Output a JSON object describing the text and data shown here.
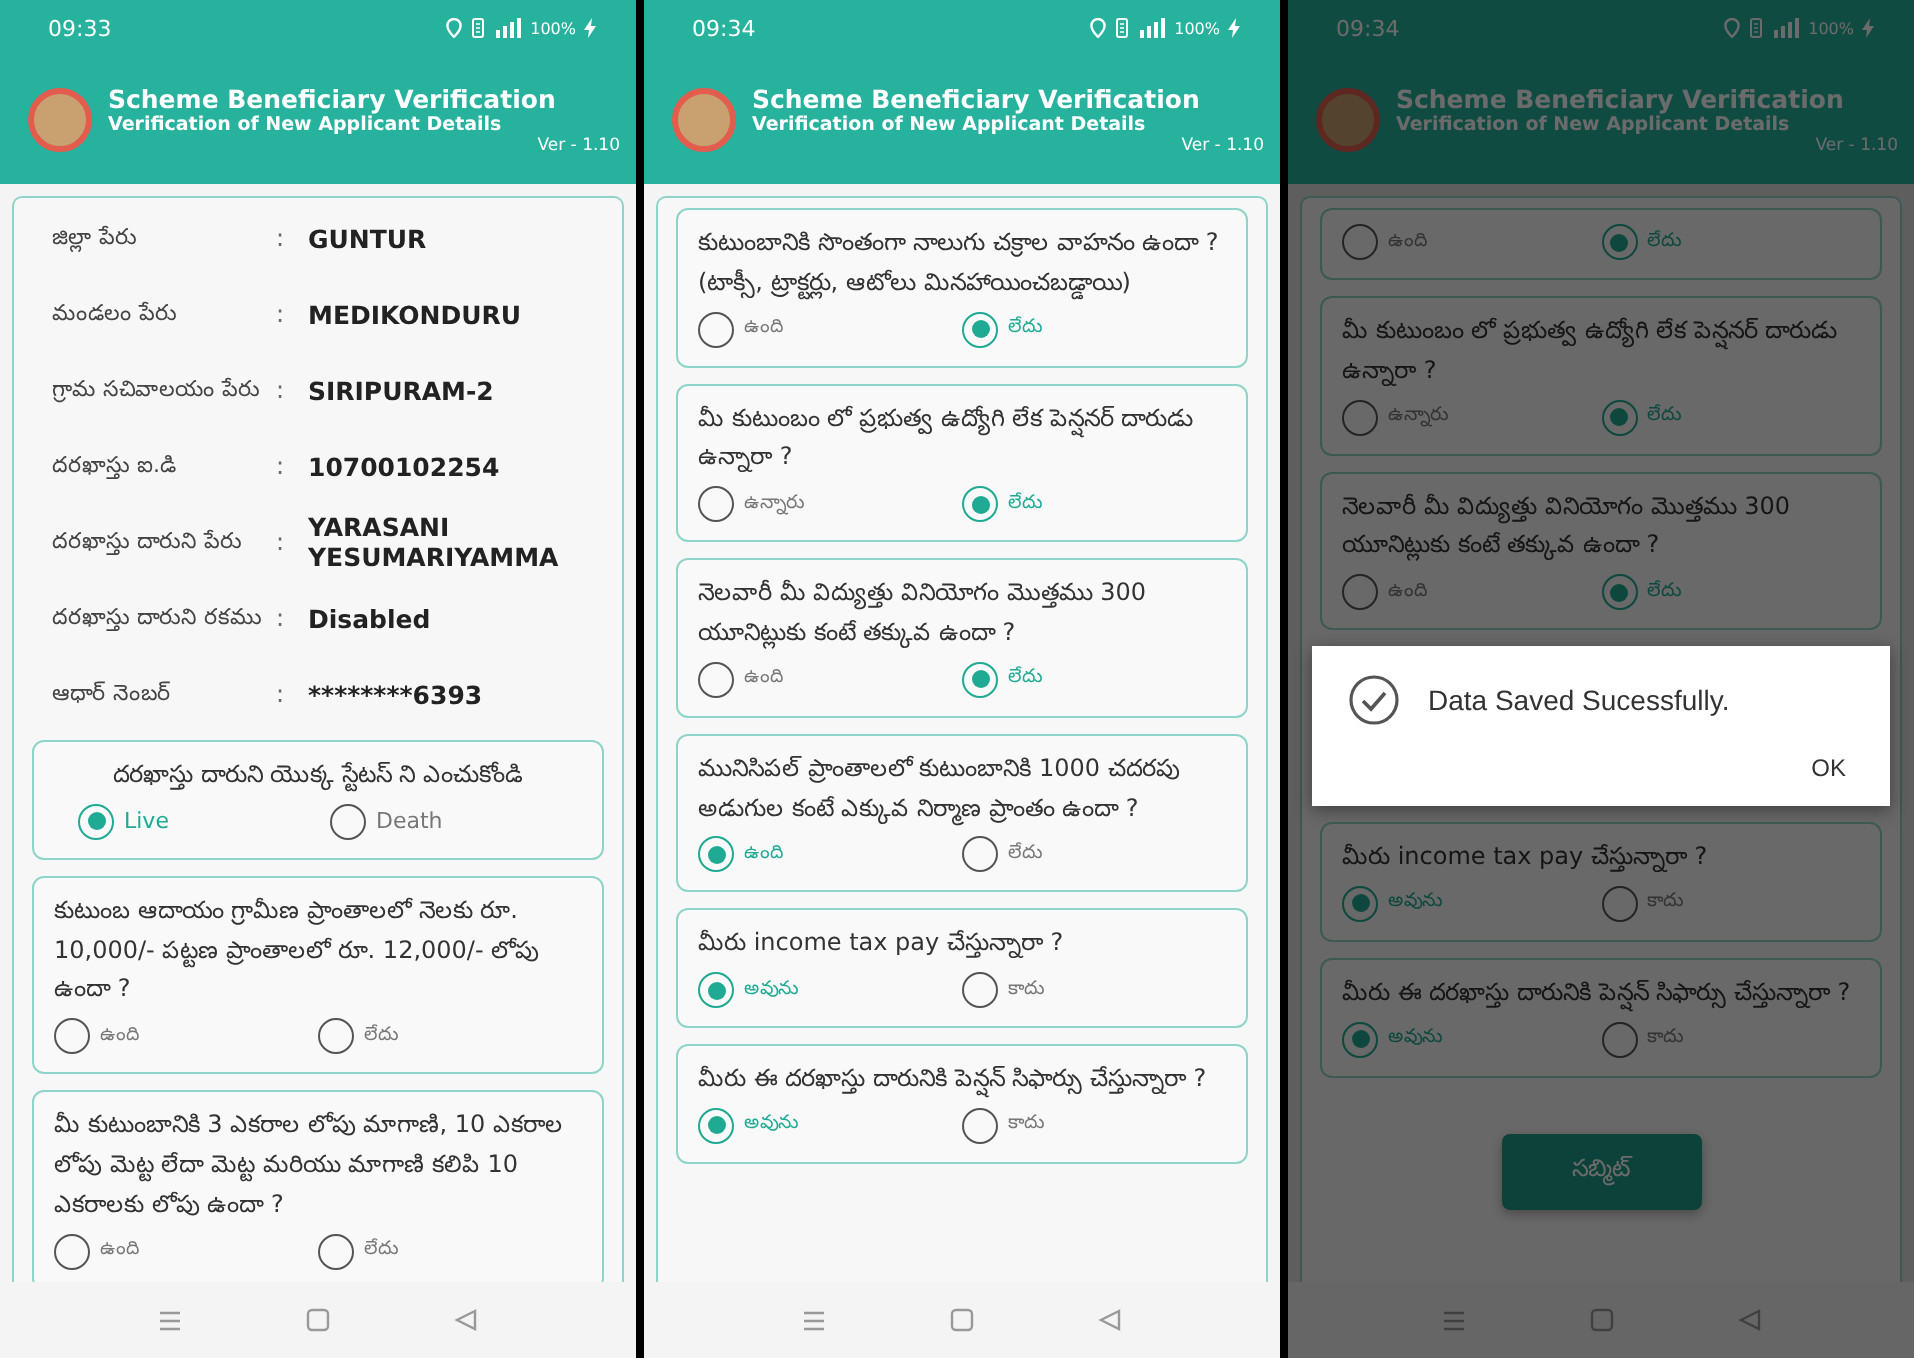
{
  "screens": [
    {
      "status_bar": {
        "time": "09:33",
        "battery": "100%"
      },
      "header": {
        "title": "Scheme Beneficiary Verification",
        "subtitle": "Verification of New Applicant Details",
        "version": "Ver - 1.10"
      },
      "dimmed": false,
      "details": [
        {
          "label": "జిల్లా పేరు",
          "separator": ":",
          "value": "GUNTUR"
        },
        {
          "label": "మండలం పేరు",
          "separator": ":",
          "value": "MEDIKONDURU"
        },
        {
          "label": "గ్రామ సచివాలయం పేరు",
          "separator": ":",
          "value": "SIRIPURAM-2"
        },
        {
          "label": "దరఖాస్తు ఐ.డి",
          "separator": ":",
          "value": "10700102254"
        },
        {
          "label": "దరఖాస్తు దారుని పేరు",
          "separator": ":",
          "value": "YARASANI YESUMARIYAMMA"
        },
        {
          "label": "దరఖాస్తు దారుని రకము",
          "separator": ":",
          "value": "Disabled"
        },
        {
          "label": "ఆధార్ నెంబర్",
          "separator": ":",
          "value": "********6393"
        }
      ],
      "cards": [
        {
          "kind": "status",
          "question": "దరఖాస్తు దారుని యొక్క స్టేటస్ ని ఎంచుకోండి",
          "options": [
            {
              "label": "Live",
              "selected": true
            },
            {
              "label": "Death",
              "selected": false
            }
          ]
        },
        {
          "kind": "question",
          "question": "కుటుంబ ఆదాయం గ్రామీణ ప్రాంతాలలో నెలకు రూ. 10,000/- పట్టణ ప్రాంతాలలో రూ. 12,000/- లోపు ఉందా ?",
          "options": [
            {
              "label": "ఉంది",
              "selected": false
            },
            {
              "label": "లేదు",
              "selected": false
            }
          ]
        },
        {
          "kind": "question",
          "question": "మీ కుటుంబానికి 3 ఎకరాల లోపు  మాగాణి, 10 ఎకరాల లోపు  మెట్ట లేదా మెట్ట మరియు మాగాణి కలిపి 10 ఎకరాలకు లోపు  ఉందా ?",
          "options": [
            {
              "label": "ఉంది",
              "selected": false
            },
            {
              "label": "లేదు",
              "selected": false
            }
          ]
        }
      ]
    },
    {
      "status_bar": {
        "time": "09:34",
        "battery": "100%"
      },
      "header": {
        "title": "Scheme Beneficiary Verification",
        "subtitle": "Verification of New Applicant Details",
        "version": "Ver - 1.10"
      },
      "dimmed": false,
      "cards": [
        {
          "kind": "question",
          "question": "కుటుంబానికి సొంతంగా నాలుగు చక్రాల వాహనం ఉందా ? (టాక్సీ, ట్రాక్టర్లు, ఆటోలు మినహాయించబడ్డాయి)",
          "options": [
            {
              "label": "ఉంది",
              "selected": false
            },
            {
              "label": "లేదు",
              "selected": true
            }
          ]
        },
        {
          "kind": "question",
          "question": "మీ కుటుంబం లో ప్రభుత్వ ఉద్యోగి లేక  పెన్షనర్ దారుడు ఉన్నారా  ?",
          "options": [
            {
              "label": "ఉన్నారు",
              "selected": false
            },
            {
              "label": "లేదు",
              "selected": true
            }
          ]
        },
        {
          "kind": "question",
          "question": "నెలవారీ  మీ విద్యుత్తు వినియోగం  మొత్తము 300 యూనిట్లుకు కంటే తక్కువ  ఉందా ?",
          "options": [
            {
              "label": "ఉంది",
              "selected": false
            },
            {
              "label": "లేదు",
              "selected": true
            }
          ]
        },
        {
          "kind": "question",
          "question": "మునిసిపల్ ప్రాంతాలలో కుటుంబానికి 1000 చదరపు అడుగుల కంటే ఎక్కువ నిర్మాణ ప్రాంతం ఉందా ?",
          "options": [
            {
              "label": "ఉంది",
              "selected": true
            },
            {
              "label": "లేదు",
              "selected": false
            }
          ]
        },
        {
          "kind": "question",
          "question": "మీరు income tax  pay చేస్తున్నారా ?",
          "options": [
            {
              "label": "అవును",
              "selected": true
            },
            {
              "label": "కాదు",
              "selected": false
            }
          ]
        },
        {
          "kind": "question",
          "question": "మీరు ఈ దరఖాస్తు దారునికి పెన్షన్ సిఫార్సు చేస్తున్నారా ?",
          "options": [
            {
              "label": "అవును",
              "selected": true
            },
            {
              "label": "కాదు",
              "selected": false
            }
          ]
        }
      ]
    },
    {
      "status_bar": {
        "time": "09:34",
        "battery": "100%"
      },
      "header": {
        "title": "Scheme Beneficiary Verification",
        "subtitle": "Verification of New Applicant Details",
        "version": "Ver - 1.10"
      },
      "dimmed": true,
      "cards_top": [
        {
          "kind": "question",
          "options": [
            {
              "label": "ఉంది",
              "selected": false
            },
            {
              "label": "లేదు",
              "selected": true
            }
          ]
        },
        {
          "kind": "question",
          "question": "మీ కుటుంబం లో ప్రభుత్వ ఉద్యోగి లేక  పెన్షనర్ దారుడు ఉన్నారా  ?",
          "options": [
            {
              "label": "ఉన్నారు",
              "selected": false
            },
            {
              "label": "లేదు",
              "selected": true
            }
          ]
        },
        {
          "kind": "question",
          "question": "నెలవారీ  మీ విద్యుత్తు వినియోగం  మొత్తము 300 యూనిట్లుకు కంటే తక్కువ  ఉందా ?",
          "options": [
            {
              "label": "ఉంది",
              "selected": false
            },
            {
              "label": "లేదు",
              "selected": true
            }
          ]
        }
      ],
      "dialog": {
        "message": "Data Saved Sucessfully.",
        "button": "OK"
      },
      "cards_bottom": [
        {
          "kind": "question",
          "question": "మీరు income tax  pay చేస్తున్నారా ?",
          "options": [
            {
              "label": "అవును",
              "selected": true
            },
            {
              "label": "కాదు",
              "selected": false
            }
          ]
        },
        {
          "kind": "question",
          "question": "మీరు ఈ దరఖాస్తు దారునికి పెన్షన్ సిఫార్సు చేస్తున్నారా ?",
          "options": [
            {
              "label": "అవును",
              "selected": true
            },
            {
              "label": "కాదు",
              "selected": false
            }
          ]
        }
      ],
      "submit": "సబ్మిట్"
    }
  ]
}
